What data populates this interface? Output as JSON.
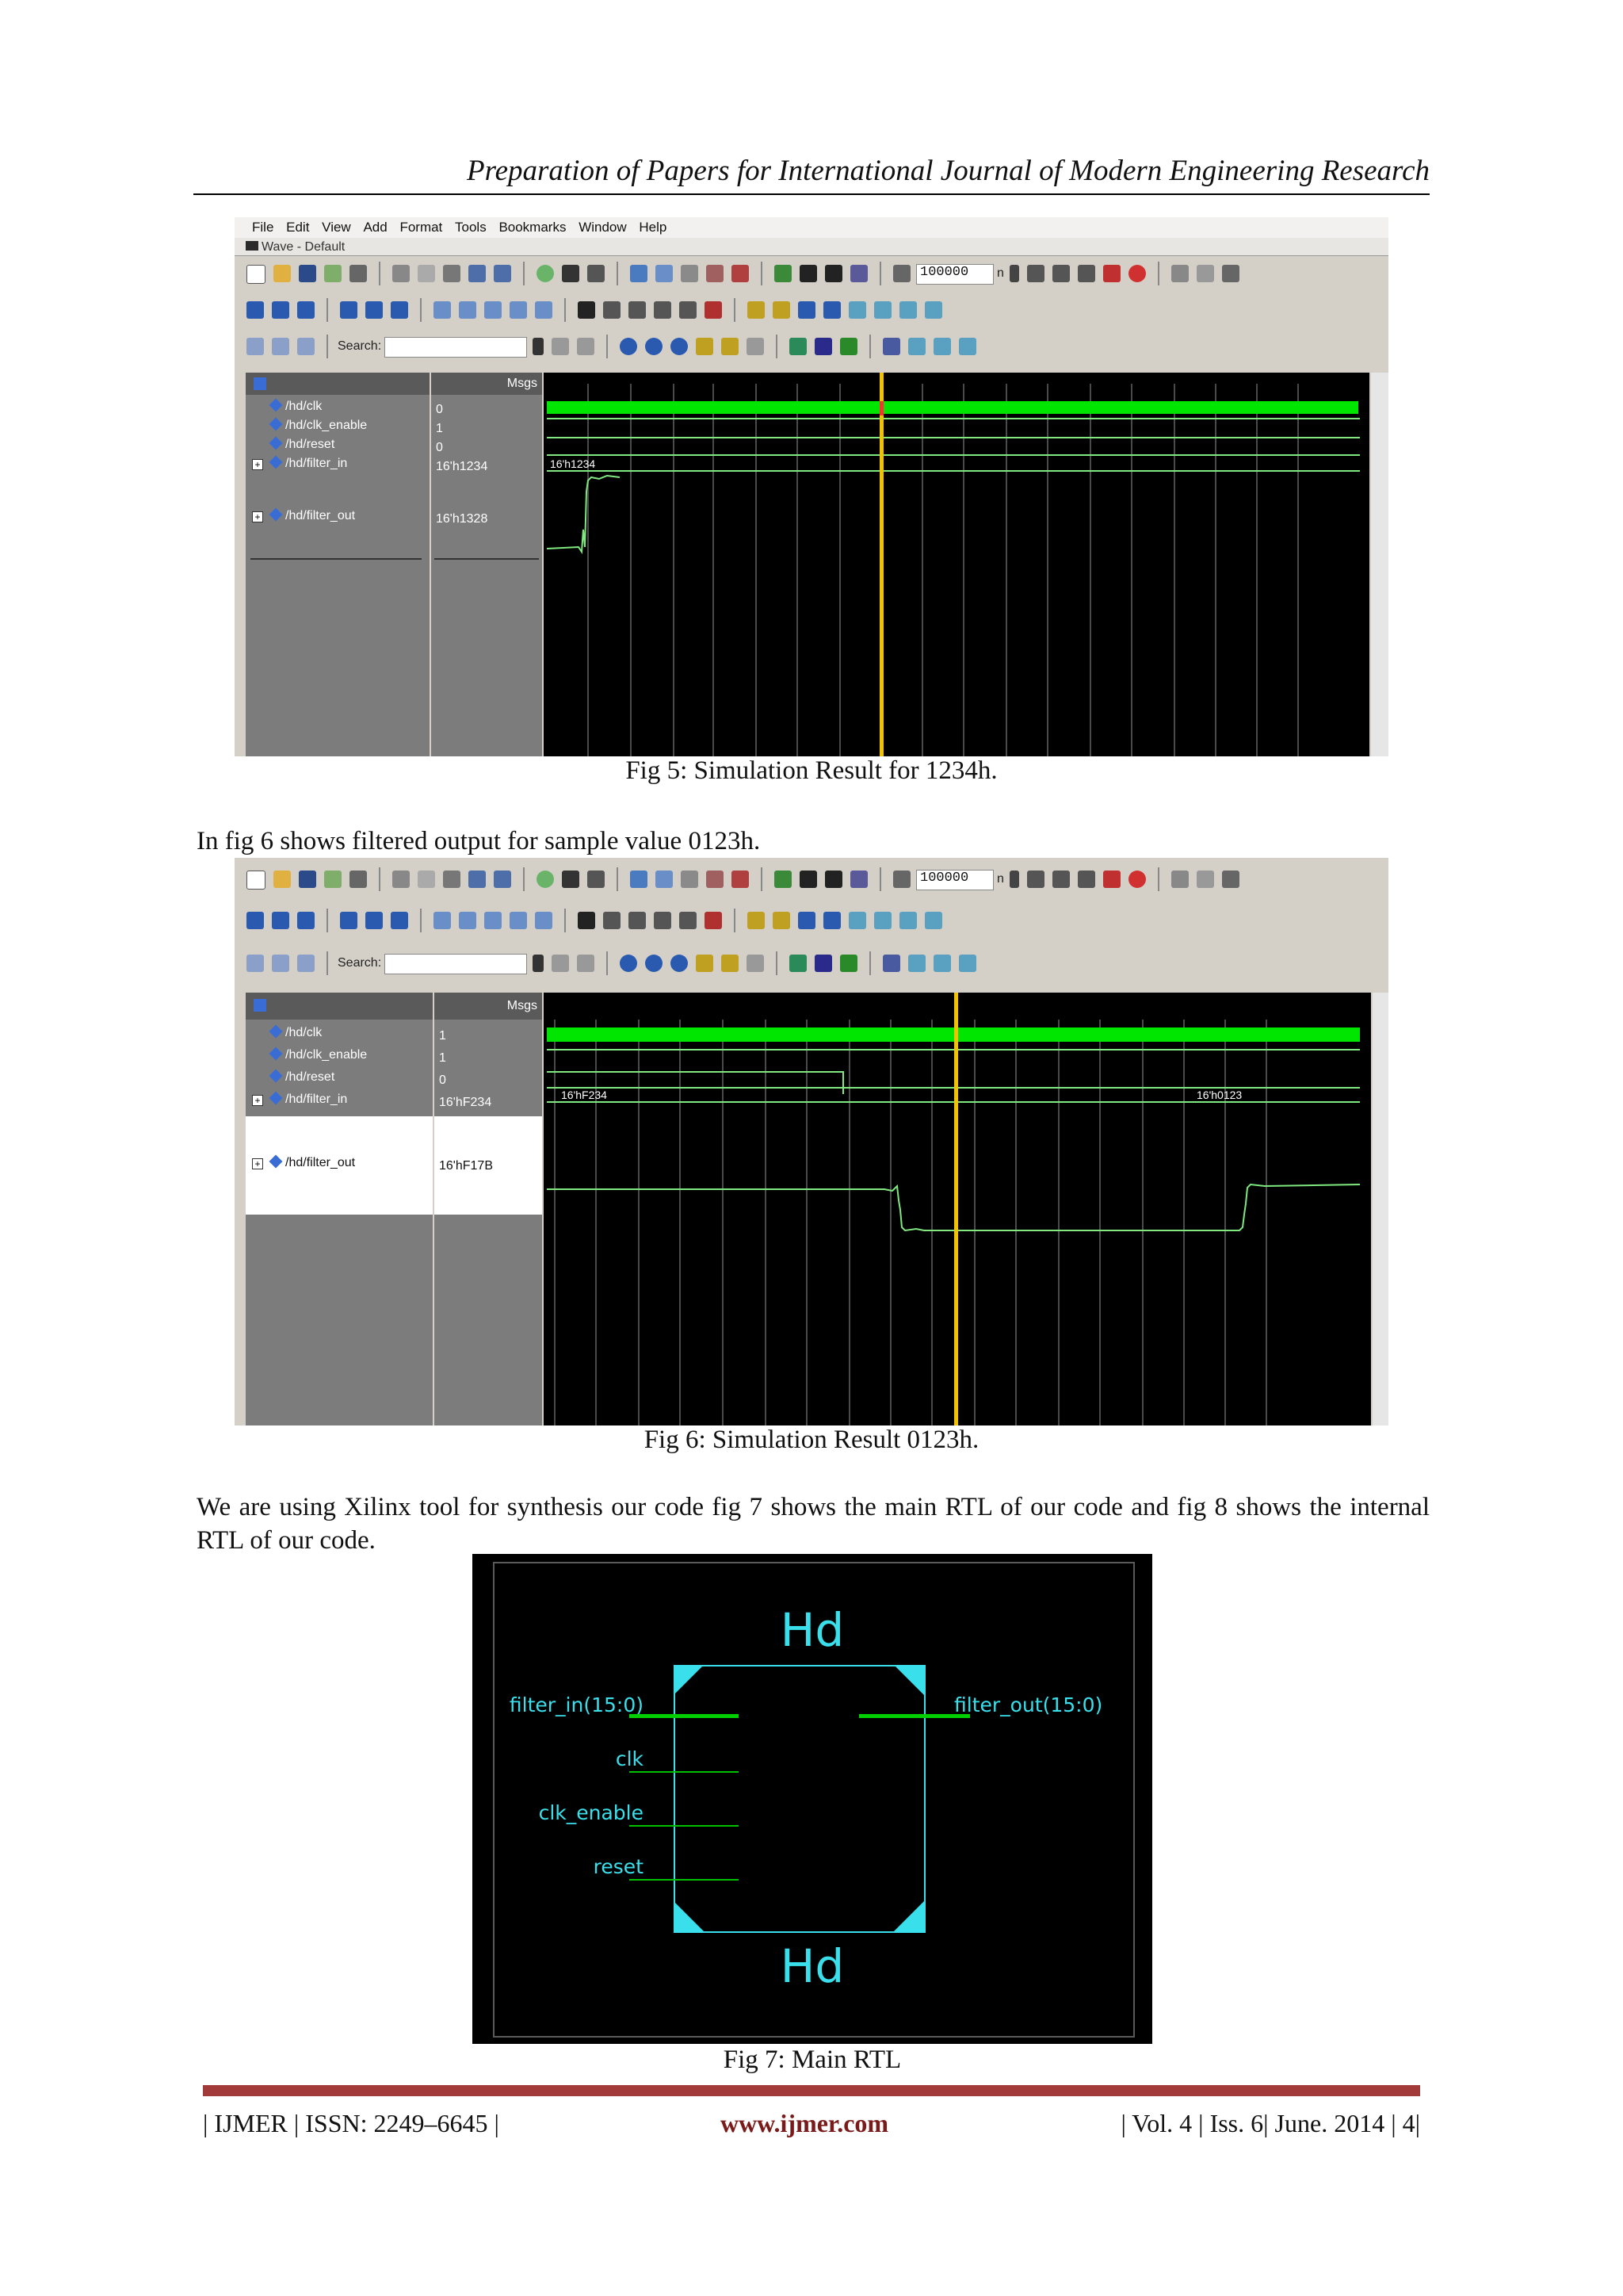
{
  "header": {
    "title": "Preparation of Papers for International Journal of Modern Engineering Research"
  },
  "figures": [
    {
      "caption": "Fig 5: Simulation Result for 1234h.",
      "menu": [
        "File",
        "Edit",
        "View",
        "Add",
        "Format",
        "Tools",
        "Bookmarks",
        "Window",
        "Help"
      ],
      "window_title": "Wave - Default",
      "sim_time": "100000",
      "time_unit": "n",
      "search_label": "Search:",
      "msgs_label": "Msgs",
      "signals": [
        {
          "name": "/hd/clk",
          "value": "0"
        },
        {
          "name": "/hd/clk_enable",
          "value": "1"
        },
        {
          "name": "/hd/reset",
          "value": "0"
        },
        {
          "name": "/hd/filter_in",
          "value": "16'h1234"
        },
        {
          "name": "/hd/filter_out",
          "value": "16'h1328"
        }
      ],
      "bus_labels": [
        "16'h1234"
      ]
    },
    {
      "caption": "Fig 6: Simulation Result 0123h.",
      "sim_time": "100000",
      "time_unit": "n",
      "search_label": "Search:",
      "msgs_label": "Msgs",
      "signals": [
        {
          "name": "/hd/clk",
          "value": "1"
        },
        {
          "name": "/hd/clk_enable",
          "value": "1"
        },
        {
          "name": "/hd/reset",
          "value": "0"
        },
        {
          "name": "/hd/filter_in",
          "value": "16'hF234"
        },
        {
          "name": "/hd/filter_out",
          "value": "16'hF17B"
        }
      ],
      "bus_labels": [
        "16'hF234",
        "16'h0123"
      ]
    }
  ],
  "paragraphs": [
    "In fig 6 shows filtered output for sample value 0123h.",
    "We are using Xilinx tool for synthesis our code fig 7 shows the main RTL of our code and fig 8 shows the internal RTL of our code."
  ],
  "rtl": {
    "caption": "Fig 7: Main RTL",
    "top_label": "Hd",
    "bottom_label": "Hd",
    "inputs": [
      "filter_in(15:0)",
      "clk",
      "clk_enable",
      "reset"
    ],
    "output": "filter_out(15:0)"
  },
  "footer": {
    "left": "| IJMER | ISSN: 2249–6645 |",
    "center": "www.ijmer.com",
    "right": "| Vol. 4 | Iss. 6| June. 2014 | 4|"
  },
  "colors": {
    "wave_bg": "#000000",
    "wave_green": "#00e600",
    "cursor": "#f2c200",
    "rtl_cyan": "#39e0ec",
    "footer_bar": "#a33a3a"
  }
}
